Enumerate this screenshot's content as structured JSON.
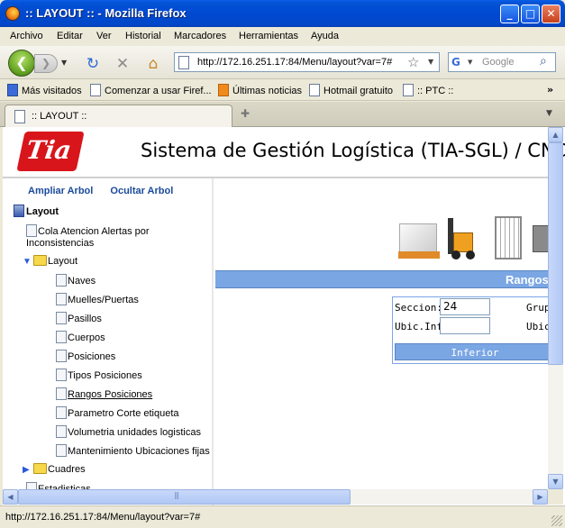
{
  "window": {
    "title": ":: LAYOUT :: - Mozilla Firefox",
    "buttons": {
      "minimize": "_",
      "maximize": "□",
      "close": "✕"
    }
  },
  "menu": [
    "Archivo",
    "Editar",
    "Ver",
    "Historial",
    "Marcadores",
    "Herramientas",
    "Ayuda"
  ],
  "navbar": {
    "url": "http://172.16.251.17:84/Menu/layout?var=7#",
    "search_placeholder": "Google"
  },
  "bookmarks": [
    "Más visitados",
    "Comenzar a usar Firef...",
    "Últimas noticias",
    "Hotmail gratuito",
    ":: PTC ::"
  ],
  "tabs": [
    {
      "label": ":: LAYOUT ::"
    }
  ],
  "page": {
    "logo_text": "Tia",
    "app_title": "Sistema de Gestión Logística (TIA-SGL) / CND",
    "sidebar": {
      "expand_tree": "Ampliar Arbol",
      "hide_tree": "Ocultar Arbol",
      "root": "Layout",
      "items": {
        "cola": "Cola Atencion Alertas por Inconsistencias",
        "layout_folder": "Layout",
        "naves": "Naves",
        "muelles": "Muelles/Puertas",
        "pasillos": "Pasillos",
        "cuerpos": "Cuerpos",
        "posiciones": "Posiciones",
        "tipos": "Tipos Posiciones",
        "rangos": "Rangos Posiciones",
        "parametro": "Parametro Corte etiqueta",
        "volumetria": "Volumetria unidades logisticas",
        "mantenimiento": "Mantenimiento Ubicaciones fijas",
        "cuadres": "Cuadres",
        "estadisticas": "Estadisticas"
      }
    },
    "section_title": "Rangos",
    "form": {
      "seccion_label": "Seccion:",
      "seccion_value": "24",
      "ubic_inf_label": "Ubic.Inf:",
      "ubic_inf_value": "",
      "grupo_label": "Grup",
      "ubic_label": "Ubic",
      "inferior_button": "Inferior"
    }
  },
  "status": "http://172.16.251.17:84/Menu/layout?var=7#",
  "colors": {
    "titlebar": "#0049d0",
    "brand_red": "#d8151b",
    "accent_blue": "#7aa6e4",
    "link_blue": "#1a4a9a"
  }
}
